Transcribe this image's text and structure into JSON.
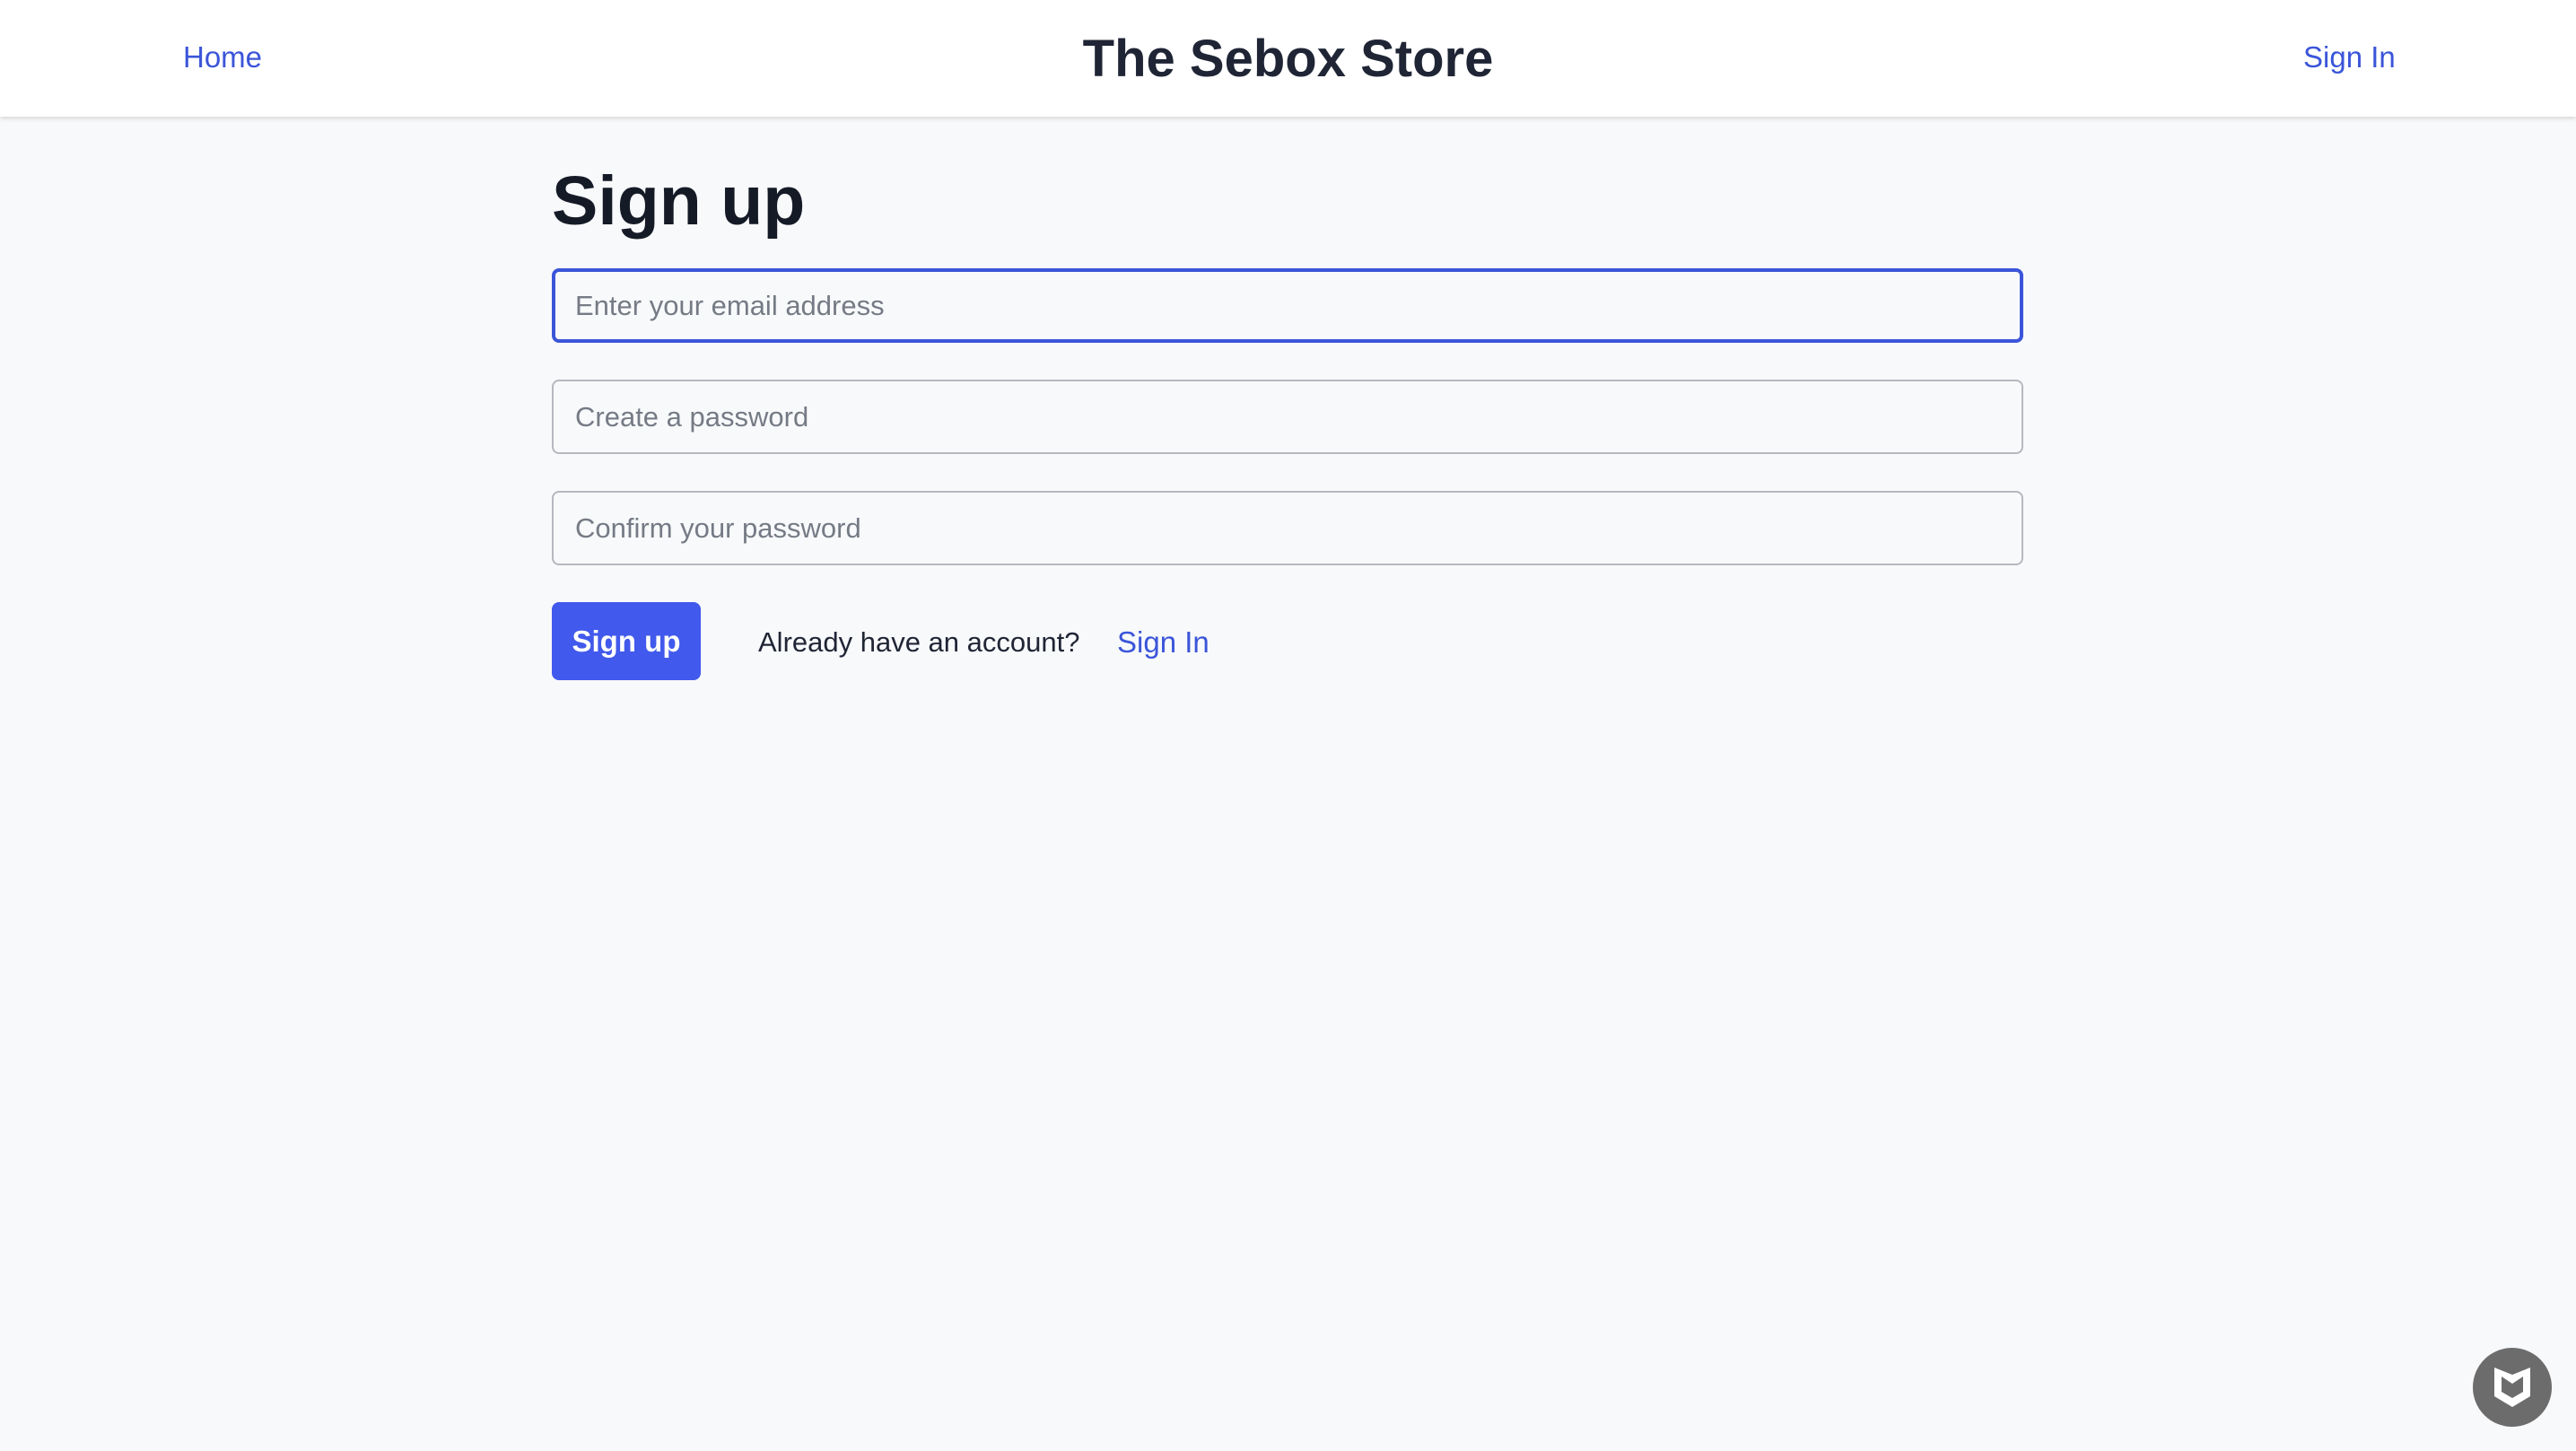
{
  "header": {
    "home_label": "Home",
    "brand": "The Sebox Store",
    "signin_label": "Sign In"
  },
  "form": {
    "title": "Sign up",
    "email_placeholder": "Enter your email address",
    "password_placeholder": "Create a password",
    "confirm_placeholder": "Confirm your password",
    "email_value": "",
    "password_value": "",
    "confirm_value": "",
    "submit_label": "Sign up",
    "have_account_text": "Already have an account?",
    "signin_link_label": "Sign In"
  },
  "colors": {
    "accent": "#4159ec",
    "link": "#3b55d9",
    "background": "#f8f9fb"
  },
  "floating_badge": {
    "icon": "shield-badge-icon"
  }
}
